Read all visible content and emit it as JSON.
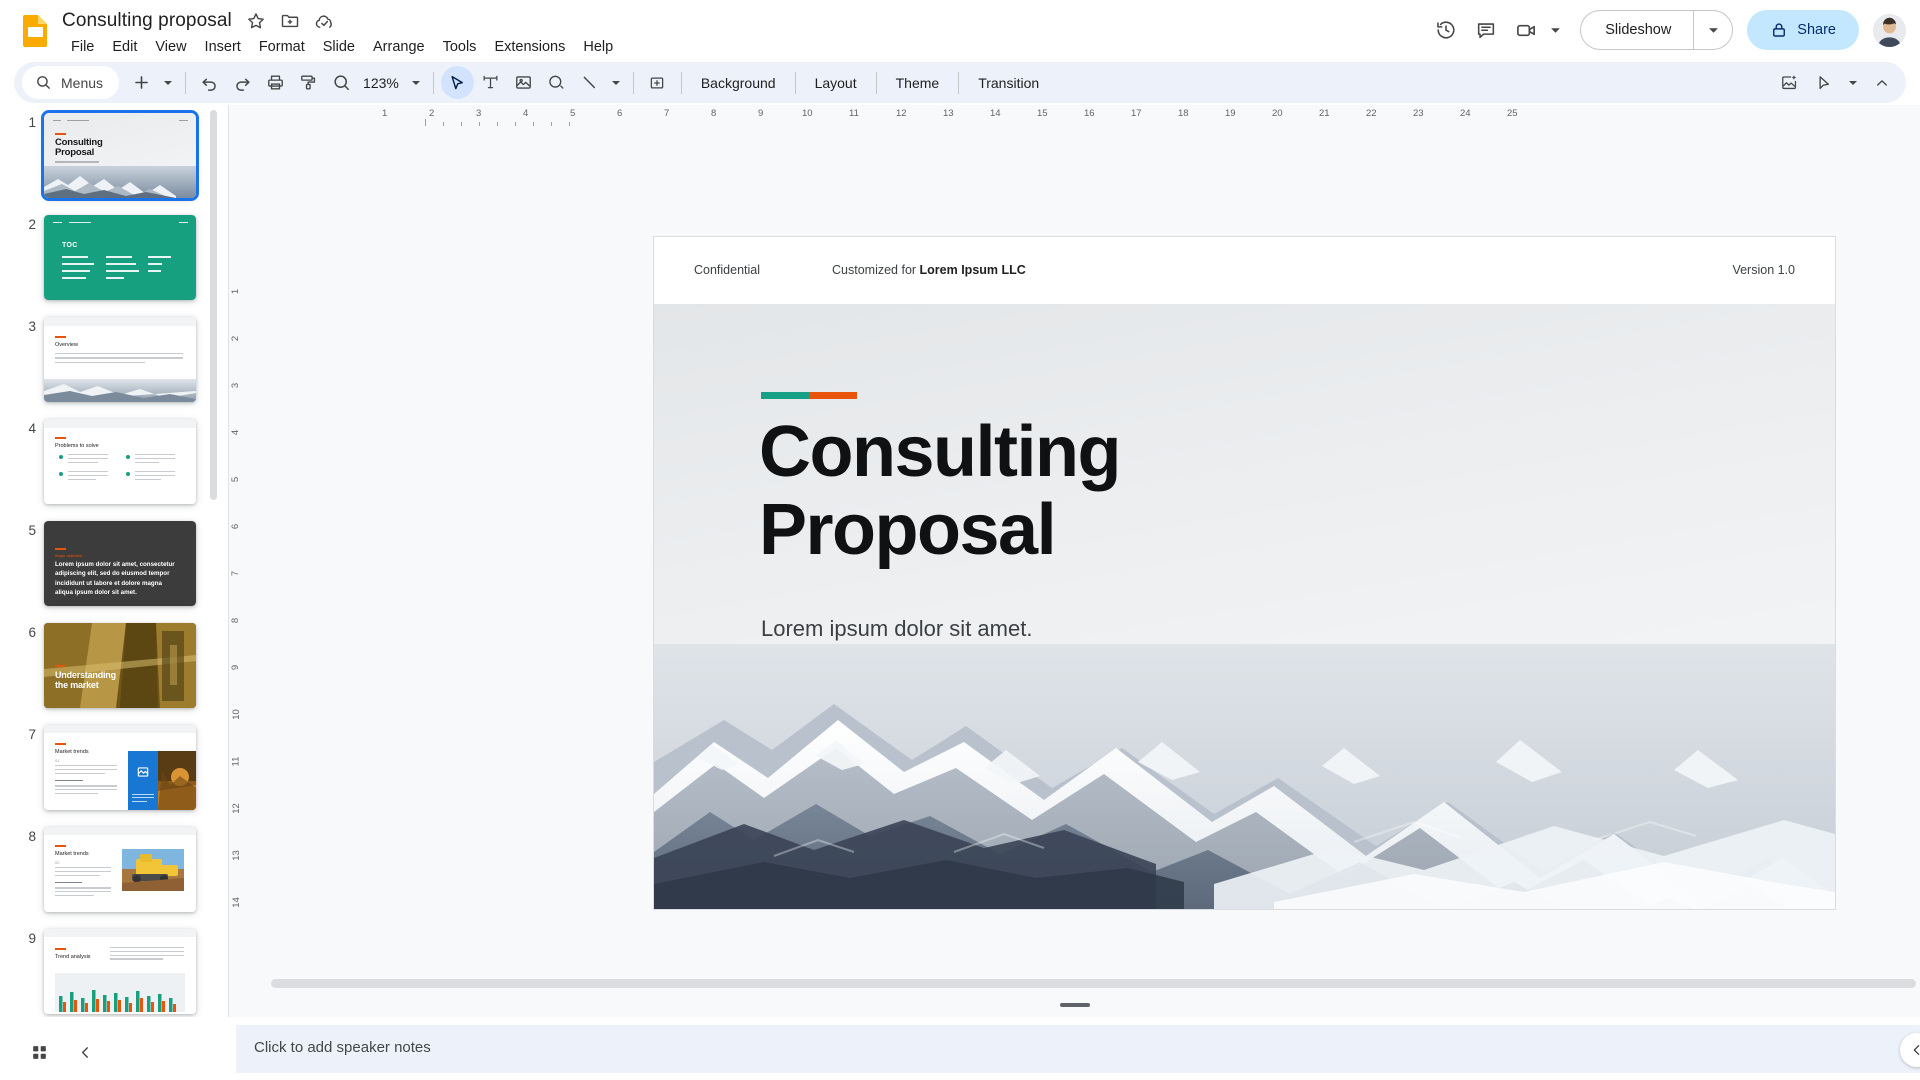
{
  "app": {
    "logo_icon": "slides-logo-icon",
    "doc_title": "Consulting proposal",
    "title_icons": [
      {
        "name": "star-icon",
        "label": "Star"
      },
      {
        "name": "move-to-folder-icon",
        "label": "Move"
      },
      {
        "name": "cloud-saved-icon",
        "label": "Saved to Drive"
      }
    ],
    "menus": [
      "File",
      "Edit",
      "View",
      "Insert",
      "Format",
      "Slide",
      "Arrange",
      "Tools",
      "Extensions",
      "Help"
    ]
  },
  "header_actions": {
    "history_icon": "version-history-icon",
    "comment_icon": "comment-icon",
    "meet_icon": "video-camera-icon",
    "slideshow_label": "Slideshow",
    "share_label": "Share",
    "share_lock_icon": "lock-icon",
    "avatar": "user-avatar"
  },
  "toolbar": {
    "menus_label": "Menus",
    "search_icon": "search-icon",
    "zoom_value": "123%",
    "buttons": [
      {
        "name": "new-slide-button",
        "icon": "plus-icon"
      },
      {
        "name": "undo-button",
        "icon": "undo-icon"
      },
      {
        "name": "redo-button",
        "icon": "redo-icon"
      },
      {
        "name": "print-button",
        "icon": "printer-icon"
      },
      {
        "name": "paint-format-button",
        "icon": "paint-format-icon"
      },
      {
        "name": "zoom-button",
        "icon": "magnifier-icon"
      },
      {
        "name": "select-tool-button",
        "icon": "cursor-arrow-icon"
      },
      {
        "name": "text-box-button",
        "icon": "text-box-icon"
      },
      {
        "name": "insert-image-button",
        "icon": "image-icon"
      },
      {
        "name": "shape-button",
        "icon": "shape-icon"
      },
      {
        "name": "line-button",
        "icon": "line-icon"
      },
      {
        "name": "insert-table-button",
        "icon": "table-icon"
      }
    ],
    "text_buttons": [
      "Background",
      "Layout",
      "Theme",
      "Transition"
    ],
    "right_buttons": [
      {
        "name": "generate-image-button",
        "icon": "image-sparkle-icon"
      },
      {
        "name": "annotate-button",
        "icon": "pen-cursor-icon"
      },
      {
        "name": "collapse-toolbar-button",
        "icon": "chevron-up-icon"
      }
    ]
  },
  "filmstrip": {
    "slides": [
      {
        "number": "1",
        "type": "title",
        "title": "Consulting\nProposal",
        "subtitle": "Lorem ipsum dolor sit amet.",
        "selected": true
      },
      {
        "number": "2",
        "type": "toc",
        "title": "TOC",
        "selected": false
      },
      {
        "number": "3",
        "type": "overview",
        "title": "Overview",
        "selected": false
      },
      {
        "number": "4",
        "type": "problems",
        "title": "Problems to solve",
        "selected": false
      },
      {
        "number": "5",
        "type": "quote",
        "title": "Begin objective",
        "body": "Lorem ipsum dolor sit amet, consectetur adipiscing elit, sed do eiusmod tempor incididunt ut labore et dolore magna aliqua ipsum dolor sit amet.",
        "selected": false
      },
      {
        "number": "6",
        "type": "section",
        "title": "Understanding\nthe market",
        "selected": false
      },
      {
        "number": "7",
        "type": "market",
        "title": "Market trends",
        "subtitle": "01",
        "selected": false
      },
      {
        "number": "8",
        "type": "market2",
        "title": "Market trends",
        "subtitle": "02",
        "selected": false
      },
      {
        "number": "9",
        "type": "chart",
        "title": "Trend analysis",
        "selected": false
      }
    ]
  },
  "rulers": {
    "horizontal_labels": [
      "1",
      "2",
      "3",
      "4",
      "5",
      "6",
      "7",
      "8",
      "9",
      "10",
      "11",
      "12",
      "13",
      "14",
      "15",
      "16",
      "17",
      "18",
      "19",
      "20",
      "21",
      "22",
      "23",
      "24",
      "25"
    ],
    "vertical_labels": [
      "1",
      "2",
      "3",
      "4",
      "5",
      "6",
      "7",
      "8",
      "9",
      "10",
      "11",
      "12",
      "13",
      "14"
    ]
  },
  "slide": {
    "header": {
      "confidential": "Confidential",
      "customized_prefix": "Customized for ",
      "customized_client": "Lorem Ipsum LLC",
      "version": "Version 1.0"
    },
    "title": "Consulting\nProposal",
    "subtitle": "Lorem ipsum dolor sit amet.",
    "accent_teal": "#16a085",
    "accent_orange": "#e8540a"
  },
  "notes": {
    "placeholder": "Click to add speaker notes",
    "collapse_icon": "chevron-left-icon"
  },
  "bottom": {
    "grid_view_icon": "grid-view-icon",
    "collapse_filmstrip_icon": "chevron-left-icon"
  },
  "colors": {
    "accent_blue": "#1a73e8",
    "share_bg": "#c2e7ff",
    "toolbar_bg": "#edf2fa",
    "logo_yellow": "#fbbc04"
  }
}
